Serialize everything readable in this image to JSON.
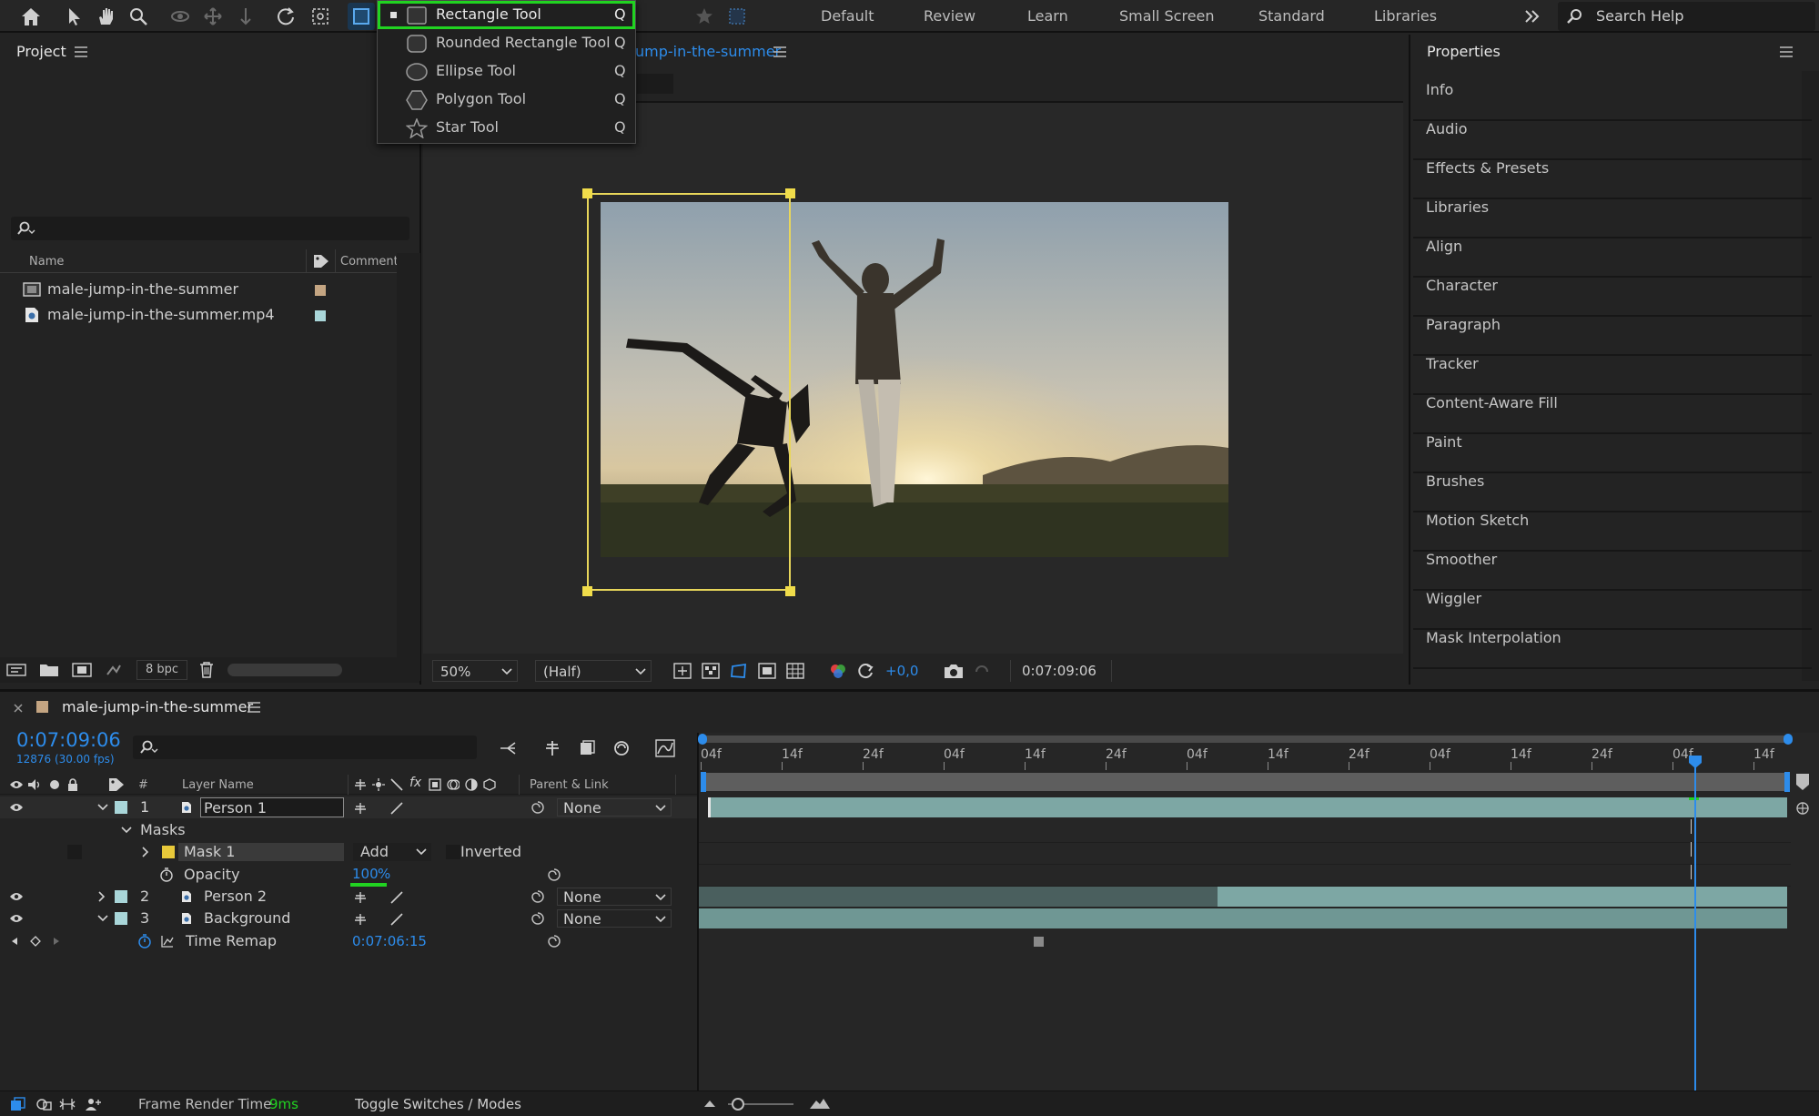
{
  "toolbar": {
    "workspaces": [
      "Default",
      "Review",
      "Learn",
      "Small Screen",
      "Standard",
      "Libraries"
    ],
    "search_placeholder": "Search Help"
  },
  "tool_menu": {
    "items": [
      {
        "label": "Rectangle Tool",
        "shortcut": "Q",
        "icon": "rectangle-icon",
        "selected": true
      },
      {
        "label": "Rounded Rectangle Tool",
        "shortcut": "Q",
        "icon": "rounded-rectangle-icon",
        "selected": false
      },
      {
        "label": "Ellipse Tool",
        "shortcut": "Q",
        "icon": "ellipse-icon",
        "selected": false
      },
      {
        "label": "Polygon Tool",
        "shortcut": "Q",
        "icon": "polygon-icon",
        "selected": false
      },
      {
        "label": "Star Tool",
        "shortcut": "Q",
        "icon": "star-icon",
        "selected": false
      }
    ]
  },
  "project": {
    "title": "Project",
    "columns": {
      "name": "Name",
      "comment": "Comment"
    },
    "items": [
      {
        "name": "male-jump-in-the-summer",
        "label_color": "#c4a582"
      },
      {
        "name": "male-jump-in-the-summer.mp4",
        "label_color": "#a9d6d9"
      }
    ],
    "bpc": "8 bpc"
  },
  "composition": {
    "tab_name": "male-jump-in-the-summer",
    "tab_visible": "ump-in-the-summer",
    "zoom": "50%",
    "resolution": "(Half)",
    "exposure": "+0,0",
    "timecode": "0:07:09:06"
  },
  "properties": {
    "title": "Properties",
    "items": [
      "Info",
      "Audio",
      "Effects & Presets",
      "Libraries",
      "Align",
      "Character",
      "Paragraph",
      "Tracker",
      "Content-Aware Fill",
      "Paint",
      "Brushes",
      "Motion Sketch",
      "Smoother",
      "Wiggler",
      "Mask Interpolation"
    ]
  },
  "timeline": {
    "comp_name": "male-jump-in-the-summer",
    "timecode": "0:07:09:06",
    "frame_info": "12876 (30.00 fps)",
    "columns": {
      "layer_name": "Layer Name",
      "parent": "Parent & Link",
      "number": "#"
    },
    "ruler_labels": [
      "04f",
      "14f",
      "24f",
      "04f",
      "14f",
      "24f",
      "04f",
      "14f",
      "24f",
      "04f",
      "14f",
      "24f",
      "04f",
      "14f"
    ],
    "layers": [
      {
        "num": "1",
        "name": "Person 1",
        "parent": "None"
      },
      {
        "num": "2",
        "name": "Person 2",
        "parent": "None"
      },
      {
        "num": "3",
        "name": "Background",
        "parent": "None"
      }
    ],
    "masks_label": "Masks",
    "mask": {
      "name": "Mask 1",
      "mode": "Add",
      "inverted": "Inverted",
      "color": "#e8c93a"
    },
    "opacity": {
      "label": "Opacity",
      "value": "100",
      "unit": "%"
    },
    "time_remap": {
      "label": "Time Remap",
      "value": "0:07:06:15"
    },
    "footer": {
      "render_label": "Frame Render Time",
      "render_value": "9ms",
      "toggle": "Toggle Switches / Modes"
    }
  },
  "colors": {
    "accent_blue": "#2d8ceb",
    "highlight_green": "#21d321",
    "mask_yellow": "#e8d65a",
    "track_teal": "#7da7a4"
  }
}
